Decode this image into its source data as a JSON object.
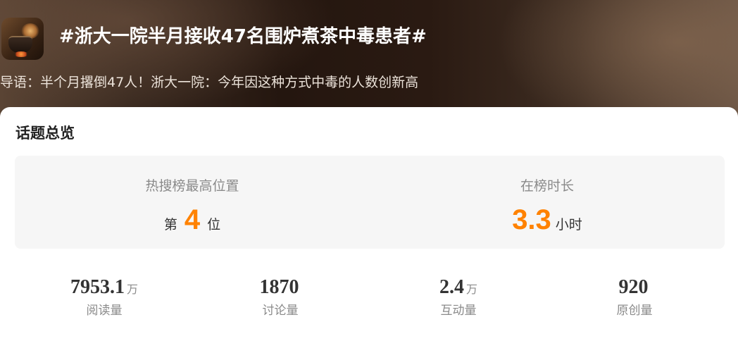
{
  "header": {
    "title": "#浙大一院半月接收47名围炉煮茶中毒患者#",
    "guide": "导语：半个月撂倒47人！浙大一院：今年因这种方式中毒的人数创新高",
    "thumbnail_icon": "tea-brewing-image"
  },
  "overview": {
    "section_title": "话题总览",
    "highest_rank": {
      "label": "热搜榜最高位置",
      "prefix": "第",
      "value": "4",
      "suffix": "位"
    },
    "duration": {
      "label": "在榜时长",
      "value": "3.3",
      "unit": "小时"
    },
    "accent_color": "#ff8200"
  },
  "stats": [
    {
      "value": "7953.1",
      "unit": "万",
      "label": "阅读量"
    },
    {
      "value": "1870",
      "unit": "",
      "label": "讨论量"
    },
    {
      "value": "2.4",
      "unit": "万",
      "label": "互动量"
    },
    {
      "value": "920",
      "unit": "",
      "label": "原创量"
    }
  ]
}
